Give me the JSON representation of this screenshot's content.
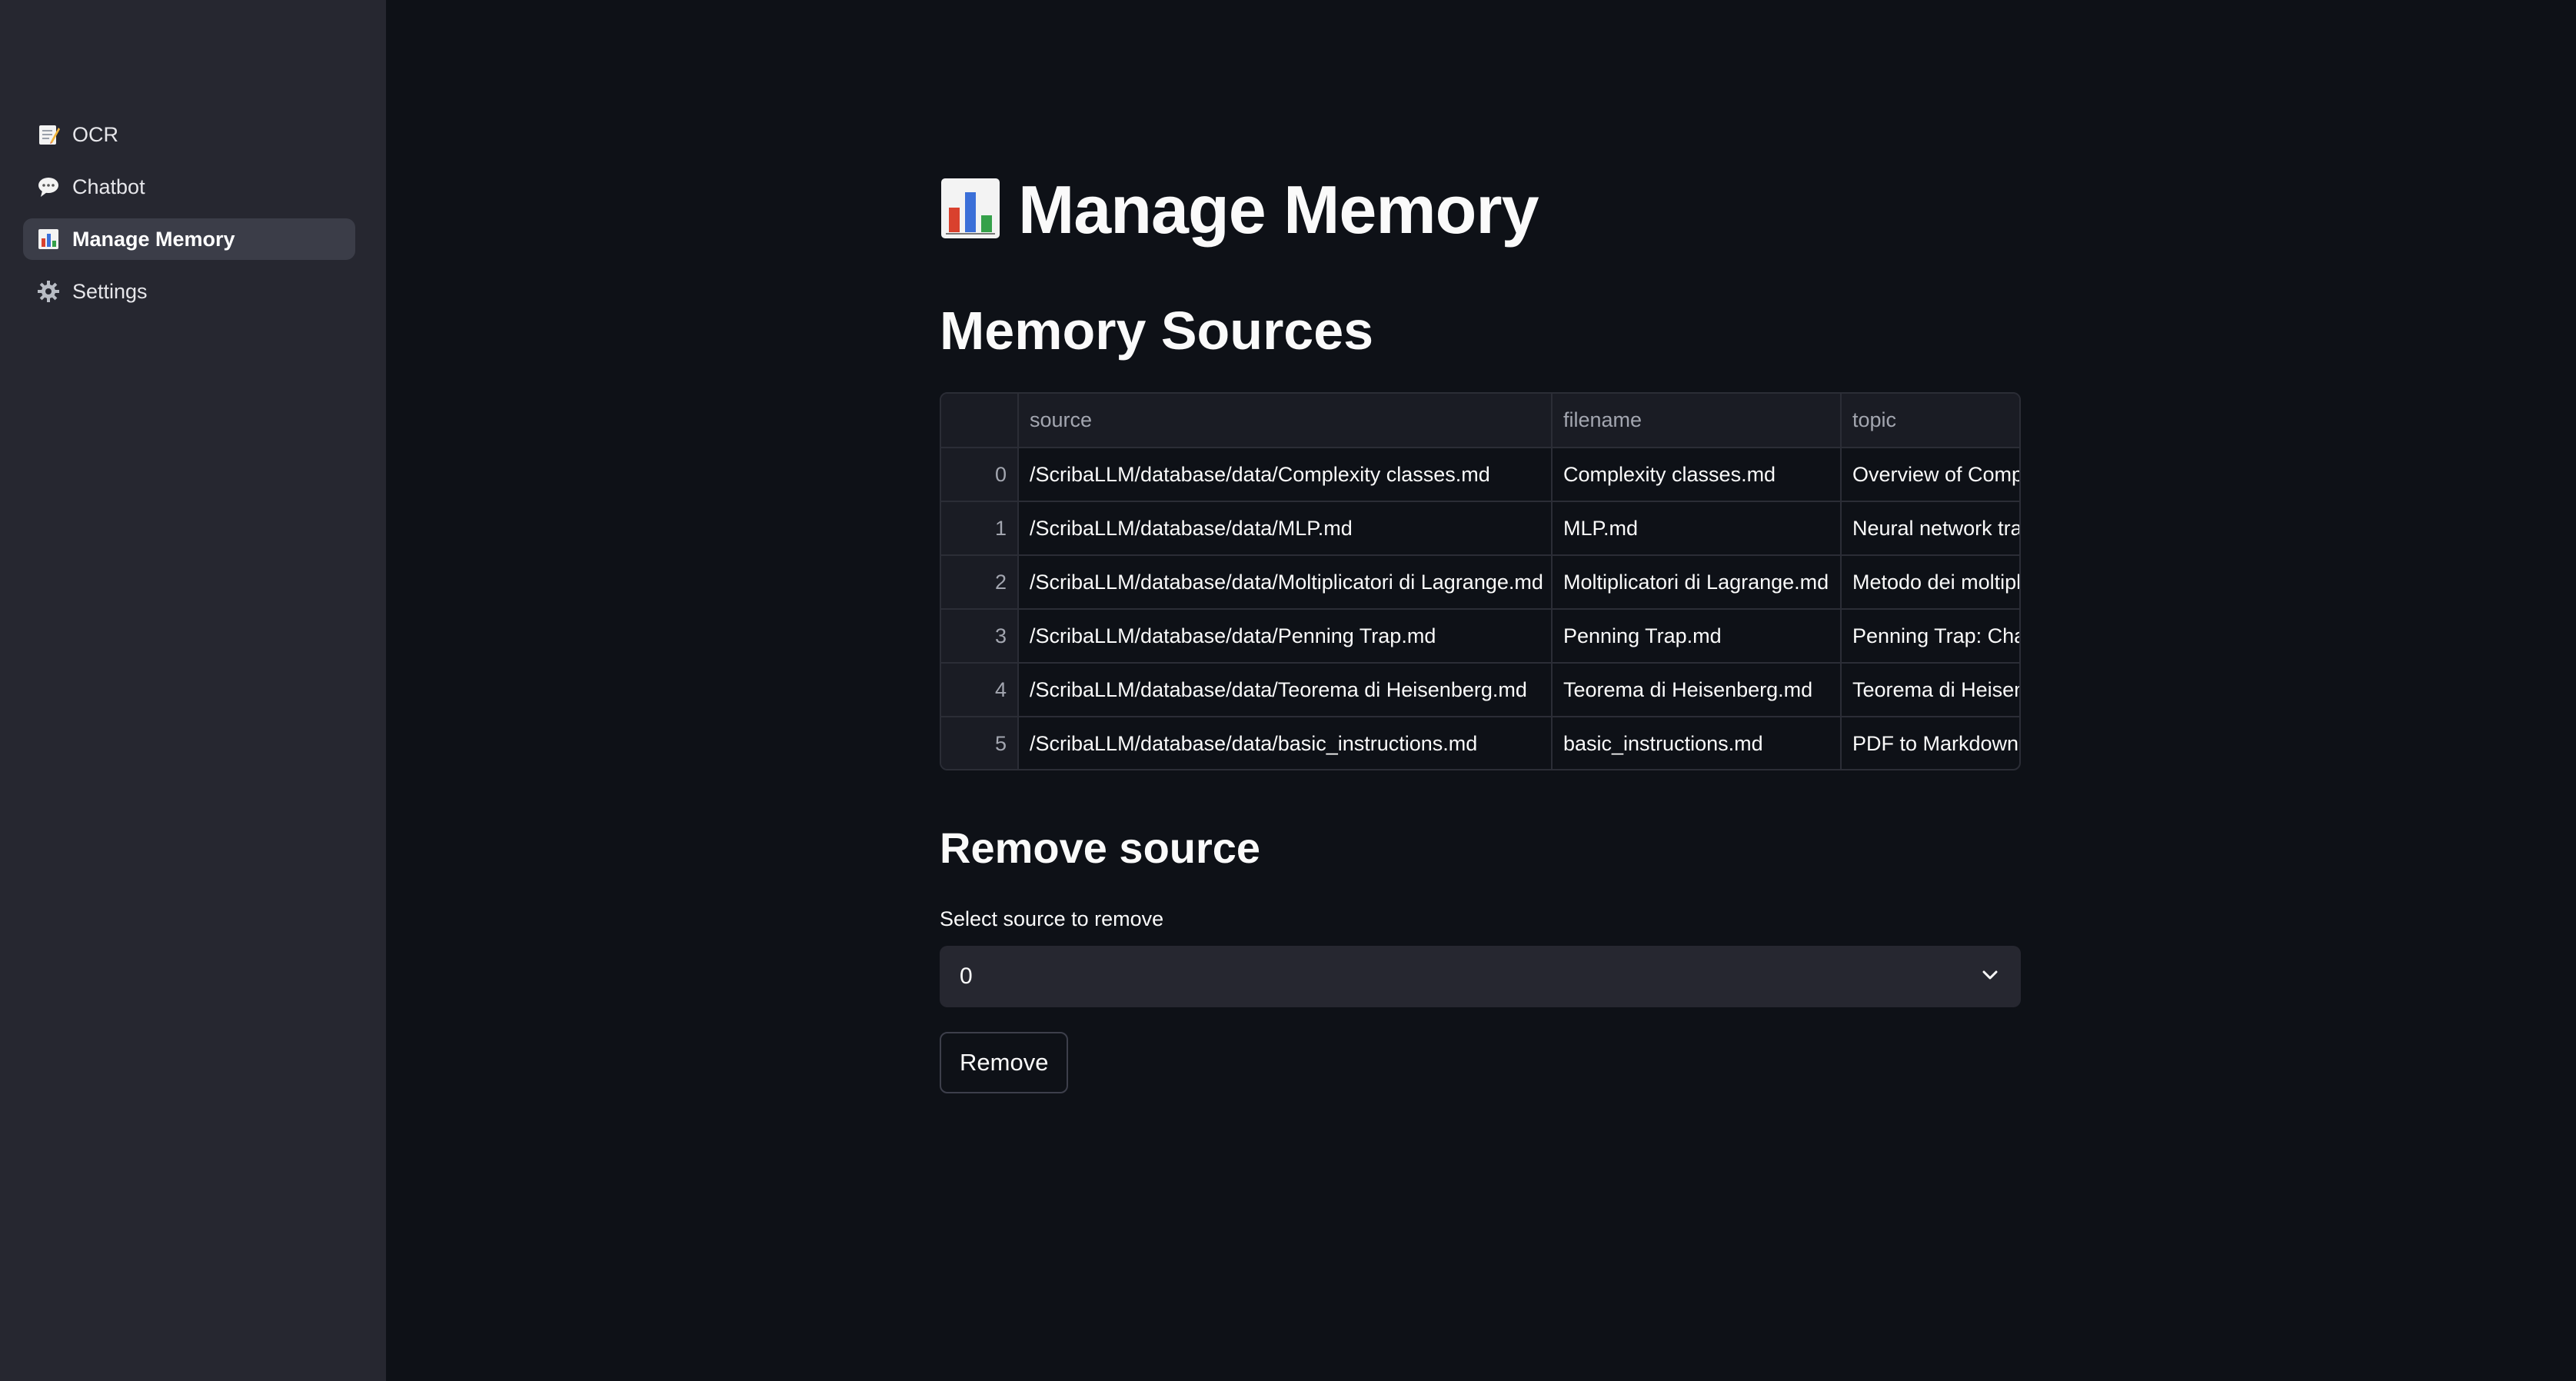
{
  "sidebar": {
    "items": [
      {
        "label": "OCR",
        "icon": "memo-icon"
      },
      {
        "label": "Chatbot",
        "icon": "speech-bubble-icon"
      },
      {
        "label": "Manage Memory",
        "icon": "bar-chart-icon",
        "active": true
      },
      {
        "label": "Settings",
        "icon": "gear-icon"
      }
    ]
  },
  "main": {
    "title": "Manage Memory",
    "title_icon": "bar-chart-icon",
    "sources_heading": "Memory Sources",
    "table": {
      "columns": [
        "",
        "source",
        "filename",
        "topic"
      ],
      "rows": [
        {
          "index": "0",
          "source": "/ScribaLLM/database/data/Complexity classes.md",
          "filename": "Complexity classes.md",
          "topic": "Overview of Compu"
        },
        {
          "index": "1",
          "source": "/ScribaLLM/database/data/MLP.md",
          "filename": "MLP.md",
          "topic": "Neural network tra"
        },
        {
          "index": "2",
          "source": "/ScribaLLM/database/data/Moltiplicatori di Lagrange.md",
          "filename": "Moltiplicatori di Lagrange.md",
          "topic": "Metodo dei moltipl"
        },
        {
          "index": "3",
          "source": "/ScribaLLM/database/data/Penning Trap.md",
          "filename": "Penning Trap.md",
          "topic": "Penning Trap: Char"
        },
        {
          "index": "4",
          "source": "/ScribaLLM/database/data/Teorema di Heisenberg.md",
          "filename": "Teorema di Heisenberg.md",
          "topic": "Teorema di Heisen"
        },
        {
          "index": "5",
          "source": "/ScribaLLM/database/data/basic_instructions.md",
          "filename": "basic_instructions.md",
          "topic": "PDF to Markdown C"
        }
      ]
    },
    "remove_heading": "Remove source",
    "select_label": "Select source to remove",
    "select_value": "0",
    "remove_button": "Remove"
  },
  "colors": {
    "background": "#0e1117",
    "sidebar": "#262730",
    "active_item": "#3b3d48",
    "text": "#fafafa"
  }
}
